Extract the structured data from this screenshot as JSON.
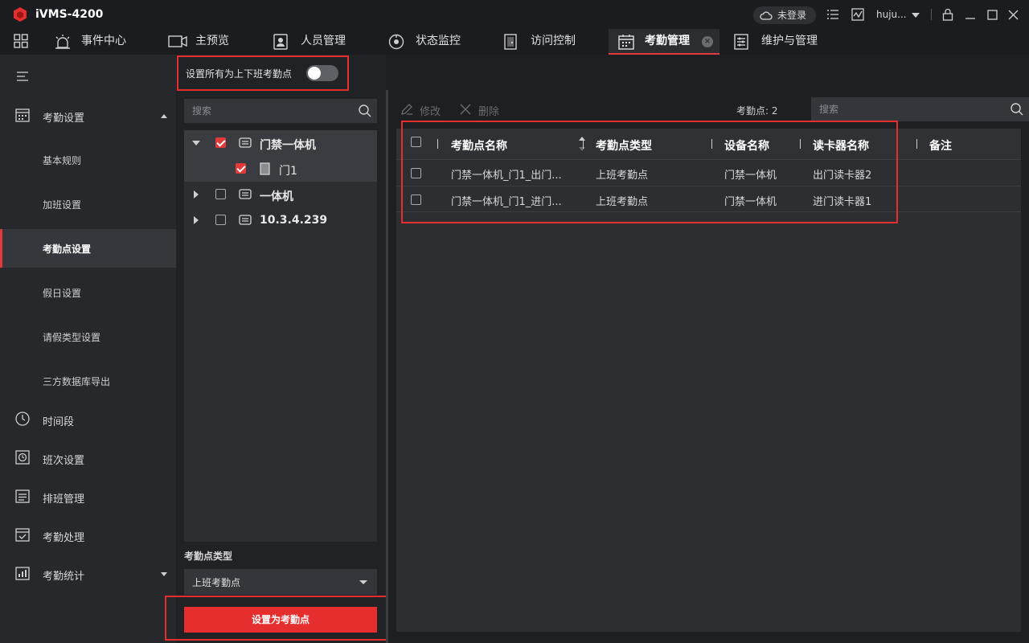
{
  "app": {
    "title": "iVMS-4200",
    "brand_color": "#e62e2e",
    "login_status": "未登录",
    "user_name": "huju..."
  },
  "nav": {
    "tabs": [
      {
        "label": "事件中心",
        "icon": "event-center-icon"
      },
      {
        "label": "主预览",
        "icon": "main-view-icon"
      },
      {
        "label": "人员管理",
        "icon": "person-management-icon"
      },
      {
        "label": "状态监控",
        "icon": "status-monitor-icon"
      },
      {
        "label": "访问控制",
        "icon": "access-control-icon"
      },
      {
        "label": "考勤管理",
        "icon": "attendance-icon",
        "active": true
      },
      {
        "label": "维护与管理",
        "icon": "maintenance-icon"
      }
    ]
  },
  "sidebar": {
    "groups": [
      {
        "label": "考勤设置",
        "icon": "calendar-settings-icon",
        "expanded": true
      },
      {
        "label": "时间段",
        "icon": "clock-icon"
      },
      {
        "label": "班次设置",
        "icon": "shift-icon"
      },
      {
        "label": "排班管理",
        "icon": "schedule-icon"
      },
      {
        "label": "考勤处理",
        "icon": "attendance-process-icon"
      },
      {
        "label": "考勤统计",
        "icon": "attendance-stats-icon",
        "expanded": false
      }
    ],
    "sub_items": [
      {
        "label": "基本规则"
      },
      {
        "label": "加班设置"
      },
      {
        "label": "考勤点设置",
        "active": true
      },
      {
        "label": "假日设置"
      },
      {
        "label": "请假类型设置"
      },
      {
        "label": "三方数据库导出"
      }
    ]
  },
  "mid": {
    "toggle_label": "设置所有为上下班考勤点",
    "toggle_on": false,
    "search_placeholder": "搜索",
    "tree": [
      {
        "label": "门禁一体机",
        "checked": true,
        "expanded": true,
        "level": 0
      },
      {
        "label": "门1",
        "checked": true,
        "level": 1
      },
      {
        "label": "一体机",
        "checked": false,
        "expanded": false,
        "level": 0
      },
      {
        "label": "10.3.4.239",
        "checked": false,
        "expanded": false,
        "level": 0
      }
    ],
    "type_label": "考勤点类型",
    "type_value": "上班考勤点",
    "set_button": "设置为考勤点"
  },
  "main": {
    "edit_label": "修改",
    "delete_label": "删除",
    "count_label": "考勤点: 2",
    "search_placeholder": "搜索",
    "columns": [
      "考勤点名称",
      "考勤点类型",
      "设备名称",
      "读卡器名称",
      "备注"
    ],
    "rows": [
      {
        "name": "门禁一体机_门1_出门...",
        "type": "上班考勤点",
        "device": "门禁一体机",
        "reader": "出门读卡器2",
        "remark": ""
      },
      {
        "name": "门禁一体机_门1_进门...",
        "type": "上班考勤点",
        "device": "门禁一体机",
        "reader": "进门读卡器1",
        "remark": ""
      }
    ]
  }
}
